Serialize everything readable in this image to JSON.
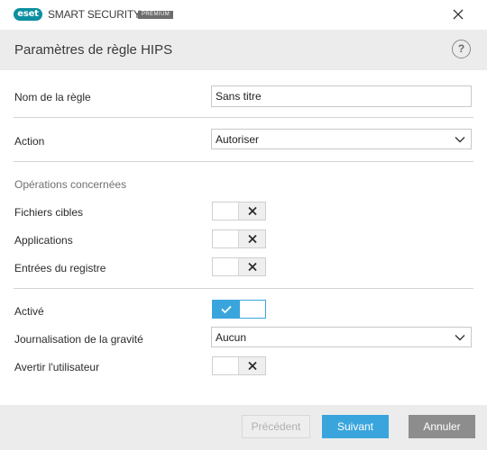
{
  "titlebar": {
    "logo_text": "eset",
    "product_name": "SMART SECURITY",
    "edition": "PREMIUM"
  },
  "header": {
    "title": "Paramètres de règle HIPS",
    "help_label": "?"
  },
  "form": {
    "rule_name": {
      "label": "Nom de la règle",
      "value": "Sans titre"
    },
    "action": {
      "label": "Action",
      "value": "Autoriser"
    },
    "operations_section": "Opérations concernées",
    "target_files": {
      "label": "Fichiers cibles",
      "enabled": false
    },
    "applications": {
      "label": "Applications",
      "enabled": false
    },
    "registry_entries": {
      "label": "Entrées du registre",
      "enabled": false
    },
    "enabled": {
      "label": "Activé",
      "enabled": true
    },
    "logging_severity": {
      "label": "Journalisation de la gravité",
      "value": "Aucun"
    },
    "notify_user": {
      "label": "Avertir l'utilisateur",
      "enabled": false
    }
  },
  "footer": {
    "previous_label": "Précédent",
    "next_label": "Suivant",
    "cancel_label": "Annuler"
  },
  "colors": {
    "accent": "#3aa5dc",
    "brand": "#0c8fa0",
    "header_bg": "#ececec",
    "cancel_bg": "#8d8d8d"
  }
}
